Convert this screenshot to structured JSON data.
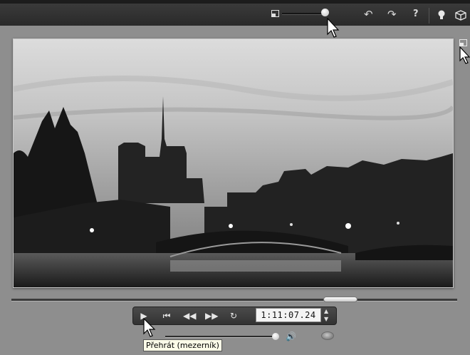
{
  "toolbar": {
    "icons": [
      "preview-size-icon",
      "zoom-slider",
      "undo-icon",
      "redo-icon",
      "help-icon",
      "lightbulb-icon",
      "box-icon"
    ],
    "undo_glyph": "↶",
    "redo_glyph": "↷",
    "help_glyph": "?"
  },
  "player": {
    "timecode": "1:11:07.24",
    "play_tooltip": "Přehrát (mezerník)",
    "controls": [
      "play",
      "go-to-start",
      "step-back",
      "step-forward",
      "loop"
    ],
    "volume_level": 0.96,
    "scrub_position": 0.7
  },
  "preview": {
    "content": "night-skyline-video-frame"
  }
}
